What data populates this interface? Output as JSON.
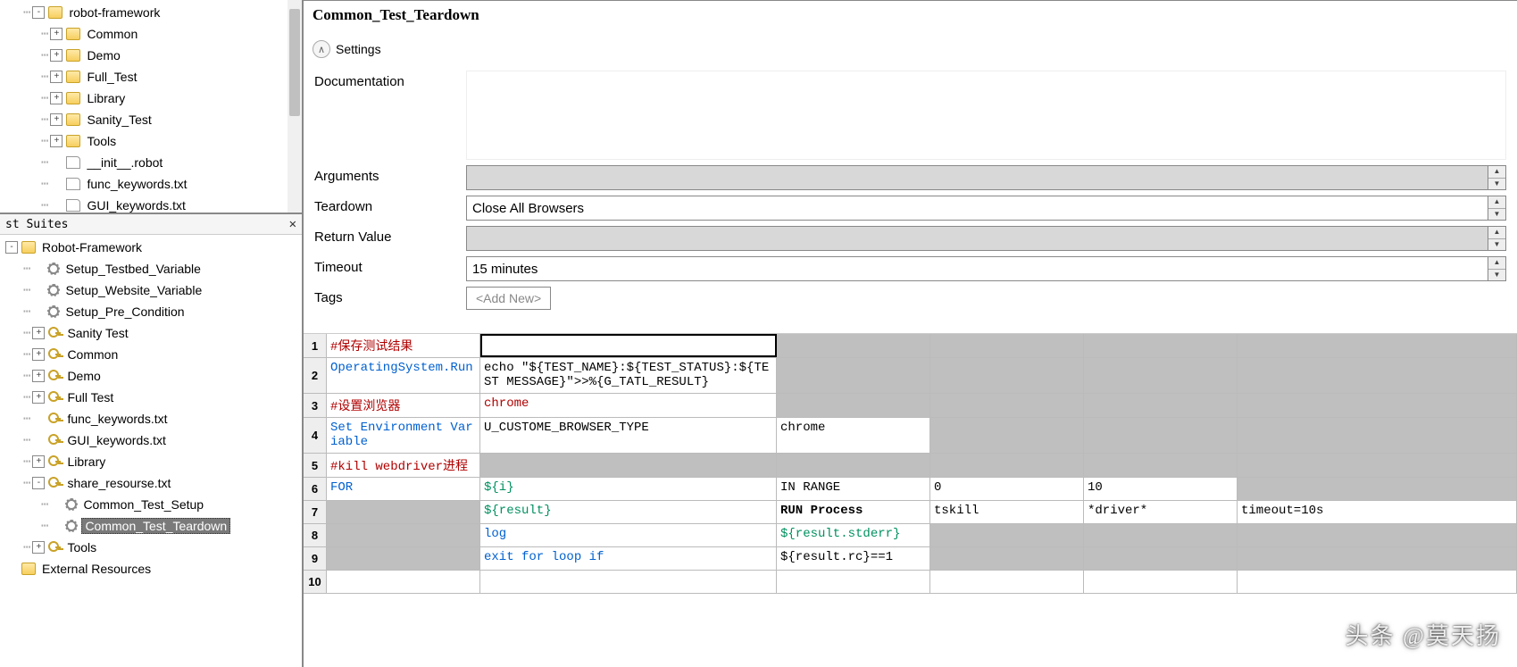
{
  "title": "Common_Test_Teardown",
  "settings_label": "Settings",
  "form": {
    "documentation_label": "Documentation",
    "arguments_label": "Arguments",
    "arguments_value": "",
    "teardown_label": "Teardown",
    "teardown_value": "Close All Browsers",
    "return_label": "Return Value",
    "return_value": "",
    "timeout_label": "Timeout",
    "timeout_value": "15 minutes",
    "tags_label": "Tags",
    "addnew_label": "<Add New>"
  },
  "tree_top": [
    {
      "indent": 1,
      "exp": "-",
      "icon": "folder",
      "label": "robot-framework"
    },
    {
      "indent": 2,
      "exp": "+",
      "icon": "folder",
      "label": "Common"
    },
    {
      "indent": 2,
      "exp": "+",
      "icon": "folder",
      "label": "Demo"
    },
    {
      "indent": 2,
      "exp": "+",
      "icon": "folder",
      "label": "Full_Test"
    },
    {
      "indent": 2,
      "exp": "+",
      "icon": "folder",
      "label": "Library"
    },
    {
      "indent": 2,
      "exp": "+",
      "icon": "folder",
      "label": "Sanity_Test"
    },
    {
      "indent": 2,
      "exp": "+",
      "icon": "folder",
      "label": "Tools"
    },
    {
      "indent": 2,
      "exp": "",
      "icon": "file",
      "label": "__init__.robot"
    },
    {
      "indent": 2,
      "exp": "",
      "icon": "file",
      "label": "func_keywords.txt"
    },
    {
      "indent": 2,
      "exp": "",
      "icon": "file",
      "label": "GUI_keywords.txt"
    }
  ],
  "suites_title": "st Suites",
  "tree_bottom": [
    {
      "indent": 0,
      "exp": "-",
      "icon": "folder",
      "label": "Robot-Framework"
    },
    {
      "indent": 1,
      "exp": "",
      "icon": "gear",
      "label": "Setup_Testbed_Variable"
    },
    {
      "indent": 1,
      "exp": "",
      "icon": "gear",
      "label": "Setup_Website_Variable"
    },
    {
      "indent": 1,
      "exp": "",
      "icon": "gear",
      "label": "Setup_Pre_Condition"
    },
    {
      "indent": 1,
      "exp": "+",
      "icon": "key",
      "label": "Sanity Test"
    },
    {
      "indent": 1,
      "exp": "+",
      "icon": "key",
      "label": "Common"
    },
    {
      "indent": 1,
      "exp": "+",
      "icon": "key",
      "label": "Demo"
    },
    {
      "indent": 1,
      "exp": "+",
      "icon": "key",
      "label": "Full Test"
    },
    {
      "indent": 1,
      "exp": "",
      "icon": "key",
      "label": "func_keywords.txt"
    },
    {
      "indent": 1,
      "exp": "",
      "icon": "key",
      "label": "GUI_keywords.txt"
    },
    {
      "indent": 1,
      "exp": "+",
      "icon": "key",
      "label": "Library"
    },
    {
      "indent": 1,
      "exp": "-",
      "icon": "key",
      "label": "share_resourse.txt"
    },
    {
      "indent": 2,
      "exp": "",
      "icon": "gear",
      "label": "Common_Test_Setup"
    },
    {
      "indent": 2,
      "exp": "",
      "icon": "gear",
      "label": "Common_Test_Teardown",
      "selected": true
    },
    {
      "indent": 1,
      "exp": "+",
      "icon": "key",
      "label": "Tools"
    },
    {
      "indent": 0,
      "exp": "",
      "icon": "folder",
      "label": "External Resources"
    }
  ],
  "grid": [
    {
      "tall": false,
      "cells": [
        {
          "t": "#保存测试结果",
          "cls": "red"
        },
        {
          "t": "",
          "sel": true
        },
        {
          "t": "",
          "grey": true
        },
        {
          "t": "",
          "grey": true
        },
        {
          "t": "",
          "grey": true
        },
        {
          "t": "",
          "grey": true
        }
      ]
    },
    {
      "tall": true,
      "cells": [
        {
          "t": "OperatingSystem.Run",
          "cls": "blue"
        },
        {
          "t": "echo \"${TEST_NAME}:${TEST_STATUS}:${TEST MESSAGE}\">>%{G_TATL_RESULT}"
        },
        {
          "t": "",
          "grey": true
        },
        {
          "t": "",
          "grey": true
        },
        {
          "t": "",
          "grey": true
        },
        {
          "t": "",
          "grey": true
        }
      ]
    },
    {
      "tall": false,
      "cells": [
        {
          "t": "#设置浏览器",
          "cls": "red"
        },
        {
          "t": "chrome",
          "cls": "red"
        },
        {
          "t": "",
          "grey": true
        },
        {
          "t": "",
          "grey": true
        },
        {
          "t": "",
          "grey": true
        },
        {
          "t": "",
          "grey": true
        }
      ]
    },
    {
      "tall": true,
      "cells": [
        {
          "t": "Set Environment Variable",
          "cls": "blue"
        },
        {
          "t": "U_CUSTOME_BROWSER_TYPE"
        },
        {
          "t": "chrome"
        },
        {
          "t": "",
          "grey": true
        },
        {
          "t": "",
          "grey": true
        },
        {
          "t": "",
          "grey": true
        }
      ]
    },
    {
      "tall": false,
      "cells": [
        {
          "t": "#kill webdriver进程",
          "cls": "red"
        },
        {
          "t": "",
          "grey": true
        },
        {
          "t": "",
          "grey": true
        },
        {
          "t": "",
          "grey": true
        },
        {
          "t": "",
          "grey": true
        },
        {
          "t": "",
          "grey": true
        }
      ]
    },
    {
      "tall": false,
      "cells": [
        {
          "t": "FOR",
          "cls": "blue"
        },
        {
          "t": "${i}",
          "cls": "green"
        },
        {
          "t": "IN RANGE"
        },
        {
          "t": "0"
        },
        {
          "t": "10"
        },
        {
          "t": "",
          "grey": true
        }
      ]
    },
    {
      "tall": false,
      "cells": [
        {
          "t": "",
          "grey": true
        },
        {
          "t": "${result}",
          "cls": "green"
        },
        {
          "t": "RUN Process",
          "cls": "bold"
        },
        {
          "t": "tskill"
        },
        {
          "t": "*driver*"
        },
        {
          "t": "timeout=10s"
        }
      ]
    },
    {
      "tall": false,
      "cells": [
        {
          "t": "",
          "grey": true
        },
        {
          "t": "log",
          "cls": "blue"
        },
        {
          "t": "${result.stderr}",
          "cls": "green"
        },
        {
          "t": "",
          "grey": true
        },
        {
          "t": "",
          "grey": true
        },
        {
          "t": "",
          "grey": true
        }
      ]
    },
    {
      "tall": false,
      "cells": [
        {
          "t": "",
          "grey": true
        },
        {
          "t": "exit for loop if",
          "cls": "blue"
        },
        {
          "t": "${result.rc}==1"
        },
        {
          "t": "",
          "grey": true
        },
        {
          "t": "",
          "grey": true
        },
        {
          "t": "",
          "grey": true
        }
      ]
    },
    {
      "tall": false,
      "cells": [
        {
          "t": ""
        },
        {
          "t": ""
        },
        {
          "t": ""
        },
        {
          "t": ""
        },
        {
          "t": ""
        },
        {
          "t": ""
        }
      ]
    }
  ],
  "watermark": "头条 @莫天扬"
}
